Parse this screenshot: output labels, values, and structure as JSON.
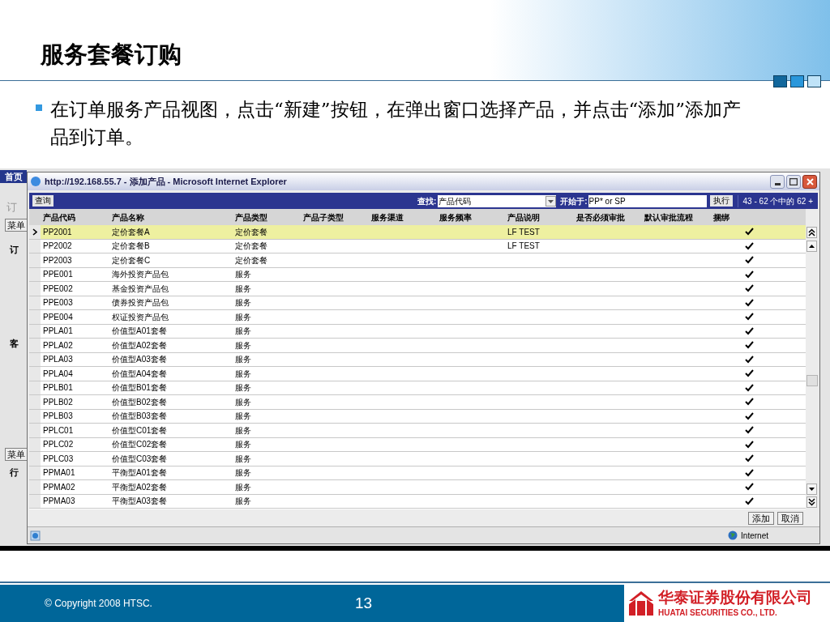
{
  "slide": {
    "title": "服务套餐订购",
    "bullets": [
      "在订单服务产品视图，点击“新建”按钮，在弹出窗口选择产品，并点击“添加”添加产品到订单。"
    ]
  },
  "background_app": {
    "left_fragments": [
      {
        "kind": "tab",
        "text": "首页"
      },
      {
        "kind": "label",
        "text": "订"
      },
      {
        "kind": "button",
        "text": "菜单"
      },
      {
        "kind": "heading",
        "text": "订"
      },
      {
        "kind": "heading",
        "text": "客"
      },
      {
        "kind": "button",
        "text": "菜单"
      },
      {
        "kind": "heading",
        "text": "行"
      }
    ]
  },
  "window": {
    "title": "http://192.168.55.7 - 添加产品 - Microsoft Internet Explorer",
    "toolbar": {
      "query_button": "查询",
      "find_label": "查找:",
      "find_field": "产品代码",
      "start_label": "开始于:",
      "start_field": "PP* or SP",
      "go_button": "执行",
      "range": "43 - 62 个中的 62 +"
    },
    "table": {
      "columns": [
        "产品代码",
        "产品名称",
        "产品类型",
        "产品子类型",
        "服务渠道",
        "服务频率",
        "产品说明",
        "是否必须审批",
        "默认审批流程",
        "捆绑"
      ],
      "rows": [
        {
          "code": "PP2001",
          "name": "定价套餐A",
          "type": "定价套餐",
          "description": "LF TEST",
          "bundled": true,
          "selected": true
        },
        {
          "code": "PP2002",
          "name": "定价套餐B",
          "type": "定价套餐",
          "description": "LF TEST",
          "bundled": true,
          "selected": false
        },
        {
          "code": "PP2003",
          "name": "定价套餐C",
          "type": "定价套餐",
          "bundled": true,
          "selected": false
        },
        {
          "code": "PPE001",
          "name": "海外投资产品包",
          "type": "服务",
          "bundled": true,
          "selected": false
        },
        {
          "code": "PPE002",
          "name": "基金投资产品包",
          "type": "服务",
          "bundled": true,
          "selected": false
        },
        {
          "code": "PPE003",
          "name": "债券投资产品包",
          "type": "服务",
          "bundled": true,
          "selected": false
        },
        {
          "code": "PPE004",
          "name": "权证投资产品包",
          "type": "服务",
          "bundled": true,
          "selected": false
        },
        {
          "code": "PPLA01",
          "name": "价值型A01套餐",
          "type": "服务",
          "bundled": true,
          "selected": false
        },
        {
          "code": "PPLA02",
          "name": "价值型A02套餐",
          "type": "服务",
          "bundled": true,
          "selected": false
        },
        {
          "code": "PPLA03",
          "name": "价值型A03套餐",
          "type": "服务",
          "bundled": true,
          "selected": false
        },
        {
          "code": "PPLA04",
          "name": "价值型A04套餐",
          "type": "服务",
          "bundled": true,
          "selected": false
        },
        {
          "code": "PPLB01",
          "name": "价值型B01套餐",
          "type": "服务",
          "bundled": true,
          "selected": false
        },
        {
          "code": "PPLB02",
          "name": "价值型B02套餐",
          "type": "服务",
          "bundled": true,
          "selected": false
        },
        {
          "code": "PPLB03",
          "name": "价值型B03套餐",
          "type": "服务",
          "bundled": true,
          "selected": false
        },
        {
          "code": "PPLC01",
          "name": "价值型C01套餐",
          "type": "服务",
          "bundled": true,
          "selected": false
        },
        {
          "code": "PPLC02",
          "name": "价值型C02套餐",
          "type": "服务",
          "bundled": true,
          "selected": false
        },
        {
          "code": "PPLC03",
          "name": "价值型C03套餐",
          "type": "服务",
          "bundled": true,
          "selected": false
        },
        {
          "code": "PPMA01",
          "name": "平衡型A01套餐",
          "type": "服务",
          "bundled": true,
          "selected": false
        },
        {
          "code": "PPMA02",
          "name": "平衡型A02套餐",
          "type": "服务",
          "bundled": true,
          "selected": false
        },
        {
          "code": "PPMA03",
          "name": "平衡型A03套餐",
          "type": "服务",
          "bundled": true,
          "selected": false
        }
      ]
    },
    "buttons": [
      "添加",
      "取消"
    ],
    "status_bar": {
      "zone": "Internet"
    }
  },
  "footer": {
    "copyright": "© Copyright 2008 HTSC.",
    "page": "13",
    "company_cn": "华泰证券股份有限公司",
    "company_en": "HUATAI SECURITIES CO., LTD."
  }
}
